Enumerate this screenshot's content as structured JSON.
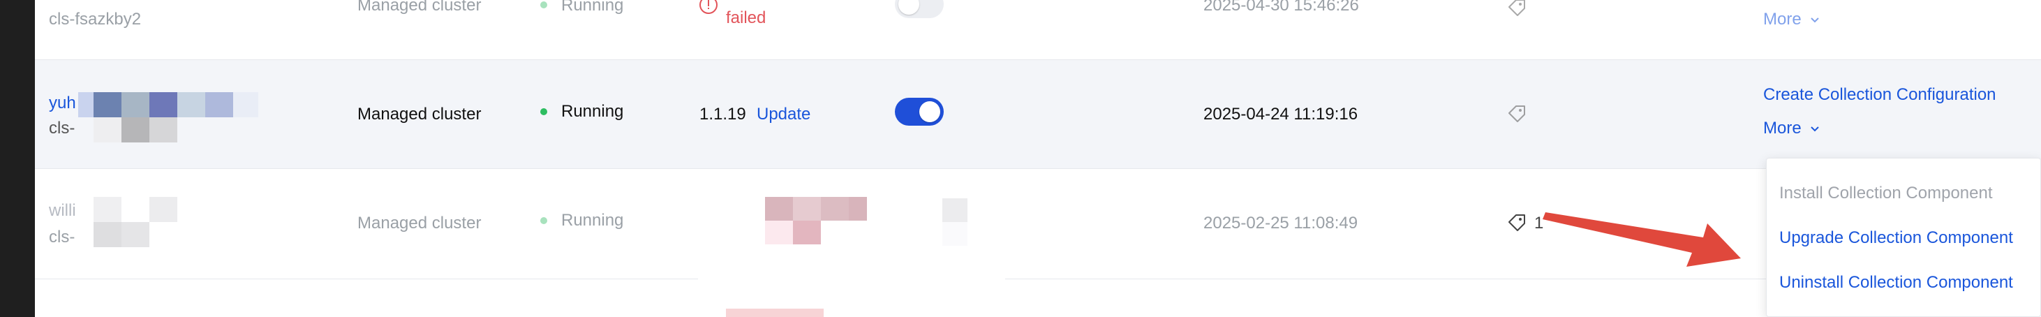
{
  "clusters": [
    {
      "id": "cls-fsazkby2",
      "type": "Managed cluster",
      "status": "Running",
      "component_status": "failed",
      "collection_enabled": false,
      "created_at": "2025-04-30 15:46:26",
      "more_label": "More"
    },
    {
      "name_prefix": "yuh",
      "id_prefix": "cls-",
      "type": "Managed cluster",
      "status": "Running",
      "component_version": "1.1.19",
      "update_label": "Update",
      "collection_enabled": true,
      "created_at": "2025-04-24 11:19:16",
      "create_config_label": "Create Collection Configuration",
      "more_label": "More"
    },
    {
      "name_prefix": "willi",
      "id_prefix": "cls-",
      "type": "Managed cluster",
      "status": "Running",
      "created_at": "2025-02-25 11:08:49",
      "tag_count": "1"
    }
  ],
  "more_menu": {
    "items": [
      {
        "label": "Install Collection Component",
        "disabled": true
      },
      {
        "label": "Upgrade Collection Component",
        "disabled": false
      },
      {
        "label": "Uninstall Collection Component",
        "disabled": false
      }
    ]
  },
  "colors": {
    "link": "#1a56db",
    "running_dot": "#2dbd61",
    "toggle_on": "#1f4fd8",
    "error": "#e2545a",
    "annotation_arrow": "#e0483c"
  },
  "icons": [
    "error-circle-icon",
    "tag-icon",
    "chevron-down-icon",
    "annotation-arrow"
  ]
}
